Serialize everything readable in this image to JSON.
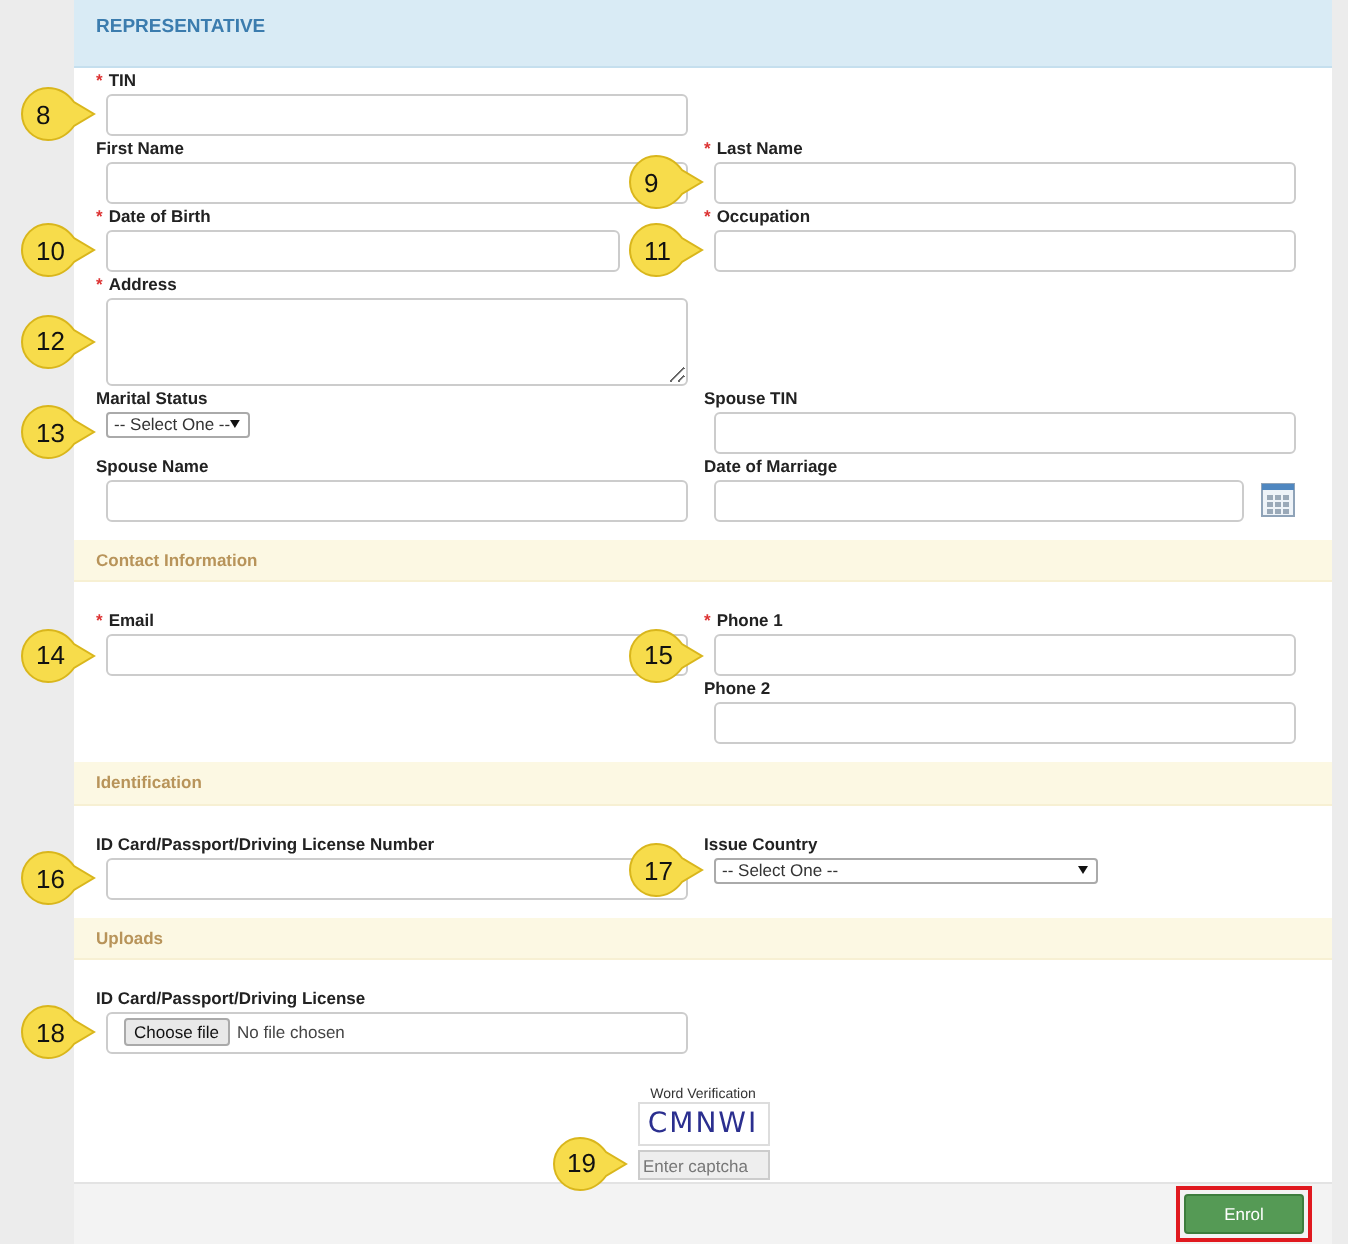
{
  "sections": [
    {
      "title": "REPRESENTATIVE",
      "kind": "primary",
      "rows": [
        {
          "left": {
            "label": "TIN",
            "required_mark": "*",
            "kind": "text",
            "callout": "8"
          }
        },
        {
          "left": {
            "label": "First Name",
            "kind": "text"
          },
          "right": {
            "label": "Last Name",
            "required_mark": "*",
            "kind": "text",
            "callout": "9"
          }
        },
        {
          "left": {
            "label": "Date of Birth",
            "required_mark": "*",
            "kind": "date",
            "callout": "10"
          },
          "right": {
            "label": "Occupation",
            "required_mark": "*",
            "kind": "text",
            "callout": "11"
          }
        },
        {
          "left": {
            "label": "Address",
            "required_mark": "*",
            "kind": "textarea",
            "callout": "12"
          }
        },
        {
          "left": {
            "label": "Marital Status",
            "kind": "compact-select",
            "value": "-- Select One --",
            "callout": "13"
          },
          "right": {
            "label": "Spouse TIN",
            "kind": "text"
          }
        },
        {
          "left": {
            "label": "Spouse Name",
            "kind": "text"
          },
          "right": {
            "label": "Date of Marriage",
            "kind": "date"
          }
        }
      ]
    },
    {
      "title": "Contact Information",
      "kind": "secondary",
      "rows": [
        {
          "left": {
            "label": "Email",
            "required_mark": "*",
            "kind": "text",
            "callout": "14"
          },
          "right": {
            "label": "Phone 1",
            "required_mark": "*",
            "kind": "text",
            "callout": "15"
          }
        },
        {
          "right": {
            "label": "Phone 2",
            "kind": "text"
          }
        }
      ]
    },
    {
      "title": "Identification",
      "kind": "secondary",
      "rows": [
        {
          "left": {
            "label": "ID Card/Passport/Driving License Number",
            "kind": "text",
            "callout": "16"
          },
          "right": {
            "label": "Issue Country",
            "kind": "select",
            "value": "-- Select One --",
            "callout": "17"
          }
        }
      ]
    },
    {
      "title": "Uploads",
      "kind": "secondary",
      "rows": [
        {
          "left": {
            "label": "ID Card/Passport/Driving License",
            "kind": "file",
            "button": "Choose file",
            "status": "No file chosen",
            "callout": "18"
          }
        }
      ]
    }
  ],
  "captcha": {
    "label": "Word Verification",
    "code": "CMNWI",
    "placeholder": "Enter captcha",
    "callout": "19"
  },
  "footer": {
    "button": "Enrol",
    "highlighted": true
  }
}
